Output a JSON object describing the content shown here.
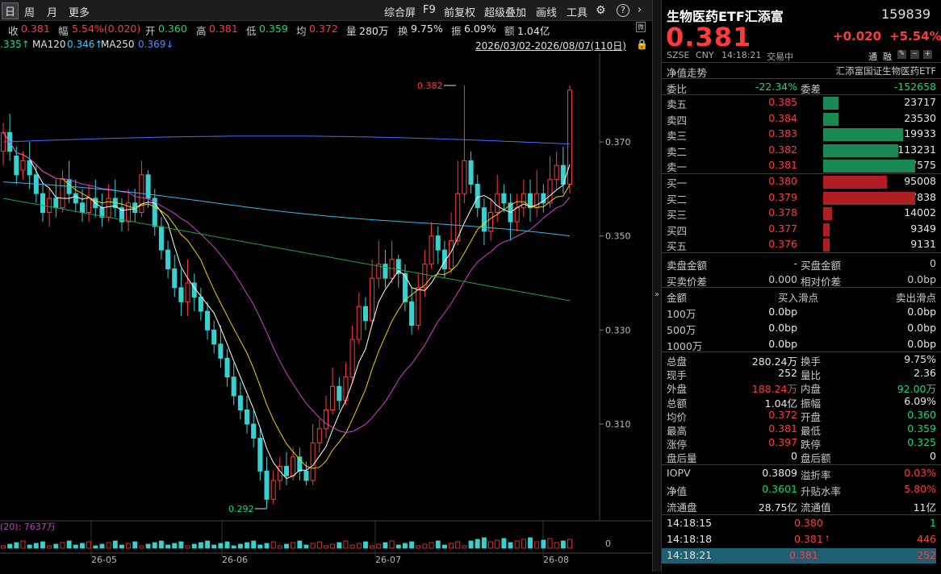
{
  "toolbar": {
    "tabs": [
      "日",
      "周",
      "月",
      "更多"
    ],
    "right_items": [
      "综合屏",
      "F9",
      "前复权",
      "超级叠加",
      "画线",
      "工具"
    ]
  },
  "info_bar": {
    "close_label": "收",
    "close": "0.381",
    "change_label": "幅",
    "change": "5.54%(0.020)",
    "open_label": "开",
    "open": "0.360",
    "high_label": "高",
    "high": "0.381",
    "low_label": "低",
    "low": "0.359",
    "avg_label": "均",
    "avg": "0.372",
    "vol_label": "量",
    "vol": "280万",
    "turnover_label": "换",
    "turnover": "9.75%",
    "amp_label": "振",
    "amp": "6.09%",
    "amount_label": "额",
    "amount": "1.04亿"
  },
  "ma_bar": {
    "ma_first": ".335↑",
    "ma120_label": "MA120",
    "ma120": "0.346↑",
    "ma250_label": "MA250",
    "ma250": "0.369↓",
    "date_range": "2026/03/02-2026/08/07(110日)"
  },
  "chart_data": {
    "type": "candlestick",
    "y_ticks": [
      "0.370",
      "0.350",
      "0.330",
      "0.310"
    ],
    "x_ticks": [
      "26-05",
      "26-06",
      "26-07",
      "26-08"
    ],
    "high_marker": "0.382",
    "low_marker": "0.292",
    "volume_label": "(20): 7637万",
    "volume_tick": "0",
    "candles": [
      [
        0.368,
        0.372,
        0.374,
        0.365
      ],
      [
        0.372,
        0.368,
        0.376,
        0.366
      ],
      [
        0.367,
        0.363,
        0.369,
        0.361
      ],
      [
        0.364,
        0.366,
        0.368,
        0.362
      ],
      [
        0.366,
        0.363,
        0.37,
        0.36
      ],
      [
        0.363,
        0.359,
        0.365,
        0.357
      ],
      [
        0.359,
        0.355,
        0.361,
        0.353
      ],
      [
        0.355,
        0.358,
        0.36,
        0.352
      ],
      [
        0.358,
        0.356,
        0.362,
        0.354
      ],
      [
        0.356,
        0.362,
        0.364,
        0.355
      ],
      [
        0.362,
        0.359,
        0.366,
        0.357
      ],
      [
        0.359,
        0.357,
        0.362,
        0.355
      ],
      [
        0.357,
        0.355,
        0.36,
        0.353
      ],
      [
        0.355,
        0.358,
        0.361,
        0.353
      ],
      [
        0.358,
        0.356,
        0.362,
        0.354
      ],
      [
        0.356,
        0.354,
        0.359,
        0.352
      ],
      [
        0.354,
        0.358,
        0.361,
        0.353
      ],
      [
        0.358,
        0.356,
        0.362,
        0.354
      ],
      [
        0.356,
        0.353,
        0.358,
        0.351
      ],
      [
        0.353,
        0.357,
        0.36,
        0.351
      ],
      [
        0.357,
        0.355,
        0.36,
        0.353
      ],
      [
        0.355,
        0.363,
        0.366,
        0.354
      ],
      [
        0.363,
        0.358,
        0.364,
        0.356
      ],
      [
        0.358,
        0.352,
        0.36,
        0.35
      ],
      [
        0.352,
        0.347,
        0.354,
        0.345
      ],
      [
        0.347,
        0.343,
        0.349,
        0.341
      ],
      [
        0.343,
        0.339,
        0.346,
        0.337
      ],
      [
        0.339,
        0.336,
        0.343,
        0.333
      ],
      [
        0.336,
        0.34,
        0.345,
        0.333
      ],
      [
        0.34,
        0.337,
        0.342,
        0.334
      ],
      [
        0.337,
        0.334,
        0.339,
        0.332
      ],
      [
        0.334,
        0.33,
        0.336,
        0.328
      ],
      [
        0.33,
        0.327,
        0.332,
        0.325
      ],
      [
        0.327,
        0.324,
        0.331,
        0.322
      ],
      [
        0.324,
        0.32,
        0.326,
        0.318
      ],
      [
        0.32,
        0.316,
        0.323,
        0.314
      ],
      [
        0.316,
        0.313,
        0.319,
        0.311
      ],
      [
        0.313,
        0.31,
        0.316,
        0.308
      ],
      [
        0.31,
        0.307,
        0.313,
        0.305
      ],
      [
        0.307,
        0.3,
        0.309,
        0.298
      ],
      [
        0.3,
        0.294,
        0.303,
        0.292
      ],
      [
        0.294,
        0.298,
        0.3,
        0.293
      ],
      [
        0.298,
        0.301,
        0.303,
        0.296
      ],
      [
        0.301,
        0.299,
        0.304,
        0.297
      ],
      [
        0.299,
        0.303,
        0.305,
        0.298
      ],
      [
        0.303,
        0.3,
        0.305,
        0.298
      ],
      [
        0.3,
        0.298,
        0.302,
        0.297
      ],
      [
        0.298,
        0.306,
        0.31,
        0.297
      ],
      [
        0.306,
        0.309,
        0.311,
        0.304
      ],
      [
        0.309,
        0.313,
        0.316,
        0.307
      ],
      [
        0.313,
        0.318,
        0.322,
        0.312
      ],
      [
        0.318,
        0.315,
        0.32,
        0.313
      ],
      [
        0.315,
        0.32,
        0.323,
        0.314
      ],
      [
        0.32,
        0.328,
        0.331,
        0.319
      ],
      [
        0.328,
        0.335,
        0.338,
        0.327
      ],
      [
        0.335,
        0.332,
        0.337,
        0.33
      ],
      [
        0.332,
        0.341,
        0.345,
        0.331
      ],
      [
        0.341,
        0.344,
        0.349,
        0.339
      ],
      [
        0.344,
        0.341,
        0.347,
        0.339
      ],
      [
        0.341,
        0.345,
        0.349,
        0.34
      ],
      [
        0.345,
        0.342,
        0.346,
        0.339
      ],
      [
        0.342,
        0.336,
        0.344,
        0.334
      ],
      [
        0.336,
        0.331,
        0.339,
        0.329
      ],
      [
        0.331,
        0.339,
        0.342,
        0.33
      ],
      [
        0.339,
        0.344,
        0.347,
        0.337
      ],
      [
        0.344,
        0.35,
        0.353,
        0.343
      ],
      [
        0.35,
        0.347,
        0.352,
        0.344
      ],
      [
        0.347,
        0.343,
        0.349,
        0.341
      ],
      [
        0.343,
        0.349,
        0.355,
        0.342
      ],
      [
        0.349,
        0.359,
        0.366,
        0.348
      ],
      [
        0.359,
        0.366,
        0.382,
        0.357
      ],
      [
        0.366,
        0.361,
        0.368,
        0.359
      ],
      [
        0.361,
        0.356,
        0.363,
        0.354
      ],
      [
        0.356,
        0.351,
        0.358,
        0.348
      ],
      [
        0.351,
        0.355,
        0.358,
        0.349
      ],
      [
        0.355,
        0.359,
        0.363,
        0.353
      ],
      [
        0.359,
        0.357,
        0.361,
        0.355
      ],
      [
        0.357,
        0.353,
        0.359,
        0.349
      ],
      [
        0.353,
        0.356,
        0.359,
        0.351
      ],
      [
        0.356,
        0.359,
        0.362,
        0.354
      ],
      [
        0.359,
        0.356,
        0.362,
        0.353
      ],
      [
        0.356,
        0.359,
        0.364,
        0.354
      ],
      [
        0.359,
        0.357,
        0.361,
        0.355
      ],
      [
        0.357,
        0.362,
        0.367,
        0.356
      ],
      [
        0.362,
        0.365,
        0.368,
        0.36
      ],
      [
        0.365,
        0.361,
        0.369,
        0.359
      ],
      [
        0.361,
        0.381,
        0.382,
        0.359
      ]
    ]
  },
  "quote": {
    "name": "生物医药ETF汇添富",
    "code": "159839",
    "price": "0.381",
    "change": "+0.020",
    "change_pct": "+5.54%",
    "market": "SZSE",
    "currency": "CNY",
    "time": "14:18:21",
    "status": "交易中",
    "tag1": "通",
    "tag2": "融",
    "nav_trend": "净值走势",
    "index_name": "汇添富国证生物医药ETF"
  },
  "weibi": {
    "label": "委比",
    "value": "-22.34%",
    "diff_label": "委差",
    "diff": "-152658"
  },
  "sell": [
    {
      "label": "卖五",
      "price": "0.385",
      "vol": "23717",
      "frac": 0.17
    },
    {
      "label": "卖四",
      "price": "0.384",
      "vol": "23530",
      "frac": 0.17
    },
    {
      "label": "卖三",
      "price": "0.383",
      "vol": "119933",
      "frac": 0.87
    },
    {
      "label": "卖二",
      "price": "0.382",
      "vol": "113231",
      "frac": 0.82
    },
    {
      "label": "卖一",
      "price": "0.381",
      "vol": "137575",
      "frac": 1.0
    }
  ],
  "buy": [
    {
      "label": "买一",
      "price": "0.380",
      "vol": "95008",
      "frac": 0.69
    },
    {
      "label": "买二",
      "price": "0.379",
      "vol": "137838",
      "frac": 1.0
    },
    {
      "label": "买三",
      "price": "0.378",
      "vol": "14002",
      "frac": 0.1
    },
    {
      "label": "买四",
      "price": "0.377",
      "vol": "9349",
      "frac": 0.07
    },
    {
      "label": "买五",
      "price": "0.376",
      "vol": "9131",
      "frac": 0.066
    }
  ],
  "disk": {
    "sell_amt_label": "卖盘金额",
    "sell_amt": "-",
    "sell_amt2_label": "买盘金额",
    "sell_amt2": "0",
    "spread_label": "买卖价差",
    "spread": "0.000",
    "rel_spread_label": "相对价差",
    "rel_spread": "0.0bp"
  },
  "slip": {
    "header": [
      "金额",
      "买入滑点",
      "卖出滑点"
    ],
    "rows": [
      [
        "100万",
        "0.0bp",
        "0.0bp"
      ],
      [
        "500万",
        "0.0bp",
        "0.0bp"
      ],
      [
        "1000万",
        "0.0bp",
        "0.0bp"
      ]
    ]
  },
  "stats": [
    {
      "l1": "总盘",
      "v1": "280.24万",
      "c1": "white",
      "l2": "换手",
      "v2": "9.75%",
      "c2": "white"
    },
    {
      "l1": "现手",
      "v1": "252",
      "c1": "white",
      "l2": "量比",
      "v2": "2.36",
      "c2": "white"
    },
    {
      "l1": "外盘",
      "v1": "188.24万",
      "c1": "red",
      "l2": "内盘",
      "v2": "92.00万",
      "c2": "green"
    },
    {
      "l1": "总额",
      "v1": "1.04亿",
      "c1": "white",
      "l2": "振幅",
      "v2": "6.09%",
      "c2": "white"
    },
    {
      "l1": "均价",
      "v1": "0.372",
      "c1": "red",
      "l2": "开盘",
      "v2": "0.360",
      "c2": "green"
    },
    {
      "l1": "最高",
      "v1": "0.381",
      "c1": "red",
      "l2": "最低",
      "v2": "0.359",
      "c2": "green"
    },
    {
      "l1": "涨停",
      "v1": "0.397",
      "c1": "red",
      "l2": "跌停",
      "v2": "0.325",
      "c2": "green"
    },
    {
      "l1": "盘后量",
      "v1": "0",
      "c1": "white",
      "l2": "盘后额",
      "v2": "0",
      "c2": "white"
    }
  ],
  "iopv": [
    {
      "l1": "IOPV",
      "v1": "0.3809",
      "c1": "white",
      "l2": "溢折率",
      "v2": "0.03%",
      "c2": "red"
    },
    {
      "l1": "净值",
      "v1": "0.3601",
      "c1": "green",
      "l2": "升贴水率",
      "v2": "5.80%",
      "c2": "red"
    },
    {
      "l1": "流通盘",
      "v1": "28.75亿",
      "c1": "white",
      "l2": "流通值",
      "v2": "11亿",
      "c2": "white"
    }
  ],
  "ticks": [
    {
      "time": "14:18:15",
      "price": "0.380",
      "vol": "1",
      "arrow": ""
    },
    {
      "time": "14:18:18",
      "price": "0.381",
      "vol": "446",
      "arrow": "🠕"
    },
    {
      "time": "14:18:21",
      "price": "0.381",
      "vol": "252",
      "arrow": ""
    }
  ]
}
